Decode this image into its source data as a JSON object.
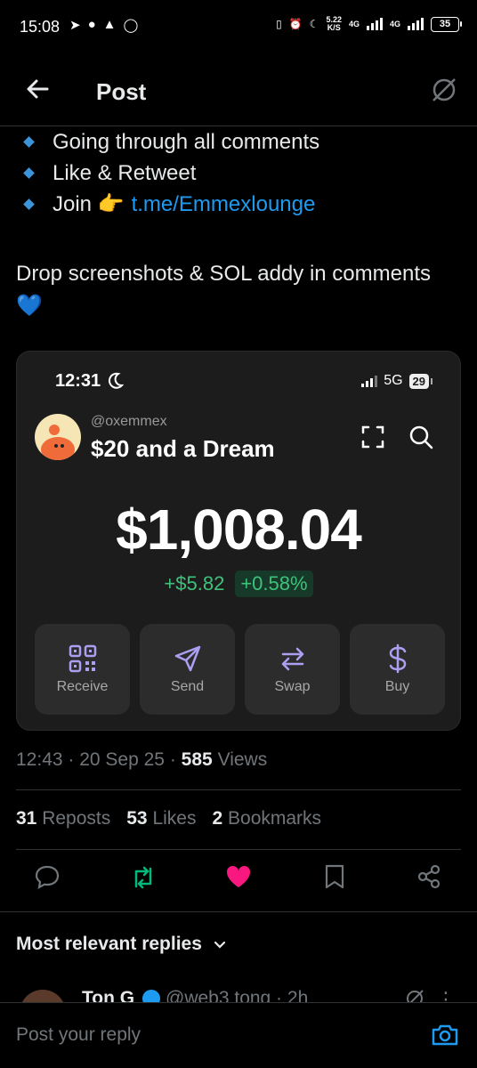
{
  "status_bar": {
    "time": "15:08",
    "left_icons": [
      "telegram-icon",
      "chat-icon",
      "snapchat-icon",
      "whatsapp-icon"
    ],
    "speed_value": "5.22",
    "speed_unit": "K/S",
    "net1": "4G",
    "net2": "4G",
    "battery": "35"
  },
  "header": {
    "title": "Post"
  },
  "post": {
    "bullets": [
      {
        "text": "Going through all comments"
      },
      {
        "text": "Like & Retweet"
      },
      {
        "text": "Join 👉",
        "link": "t.me/Emmexlounge"
      }
    ],
    "body": "Drop screenshots & SOL addy in comments 💙"
  },
  "card": {
    "time": "12:31",
    "network": "5G",
    "battery": "29",
    "handle": "@oxemmex",
    "wallet_name": "$20 and a Dream",
    "balance": "$1,008.04",
    "change_amount": "+$5.82",
    "change_percent": "+0.58%",
    "actions": [
      {
        "label": "Receive",
        "icon": "qr-code-icon"
      },
      {
        "label": "Send",
        "icon": "send-icon"
      },
      {
        "label": "Swap",
        "icon": "swap-icon"
      },
      {
        "label": "Buy",
        "icon": "dollar-icon"
      }
    ],
    "accent": "#ab9ff2",
    "positive": "#3ec27a"
  },
  "meta": {
    "time": "12:43",
    "date": "20 Sep 25",
    "views_count": "585",
    "views_label": "Views"
  },
  "stats": {
    "reposts_count": "31",
    "reposts_label": "Reposts",
    "likes_count": "53",
    "likes_label": "Likes",
    "bookmarks_count": "2",
    "bookmarks_label": "Bookmarks"
  },
  "replies": {
    "sort_label": "Most relevant replies",
    "first_reply_name": "Ton G",
    "first_reply_handle": "@web3 tong · 2h"
  },
  "composer": {
    "placeholder": "Post your reply"
  },
  "colors": {
    "like": "#f91880",
    "repost": "#00ba7c",
    "link": "#1d9bf0"
  }
}
